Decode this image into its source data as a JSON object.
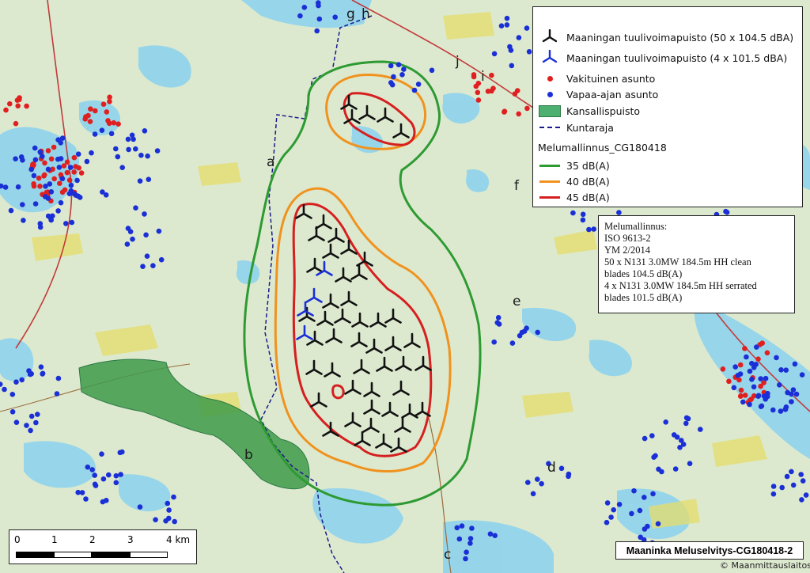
{
  "colors": {
    "contour_35": "#2e9a32",
    "contour_40": "#f0921e",
    "contour_45": "#d61f1f",
    "park": "#3f9a4a",
    "permanent_residence": "#e02020",
    "holiday_residence": "#1a2fd6",
    "turbine_main": "#111111",
    "turbine_alt": "#1a2fd6",
    "municipal_border": "#1a1a8c",
    "water": "#8fd3ec",
    "land": "#dce9cf"
  },
  "site_labels": [
    "a",
    "b",
    "c",
    "d",
    "e",
    "f",
    "g",
    "h",
    "i",
    "j"
  ],
  "legend": {
    "turbine_main_label": "Maaningan tuulivoimapuisto (50 x 104.5 dBA)",
    "turbine_alt_label": "Maaningan tuulivoimapuisto (4 x 101.5 dBA)",
    "permanent_label": "Vakituinen asunto",
    "holiday_label": "Vapaa-ajan asunto",
    "park_label": "Kansallispuisto",
    "border_label": "Kuntaraja",
    "model_heading": "Melumallinnus_CG180418",
    "contour_35_label": "35 dB(A)",
    "contour_40_label": "40 dB(A)",
    "contour_45_label": "45 dB(A)"
  },
  "info_box": {
    "lines": [
      "Melumallinnus:",
      "ISO 9613-2",
      "YM 2/2014",
      "50 x N131 3.0MW 184.5m HH clean",
      "blades 104.5 dB(A)",
      "4 x N131 3.0MW 184.5m HH serrated",
      "blades 101.5 dB(A)"
    ]
  },
  "scale_bar": {
    "labels": [
      "0",
      "1",
      "2",
      "3",
      "4 km"
    ]
  },
  "map_title": "Maaninka  Meluselvitys-CG180418-2",
  "credit": "© Maanmittauslaitos"
}
